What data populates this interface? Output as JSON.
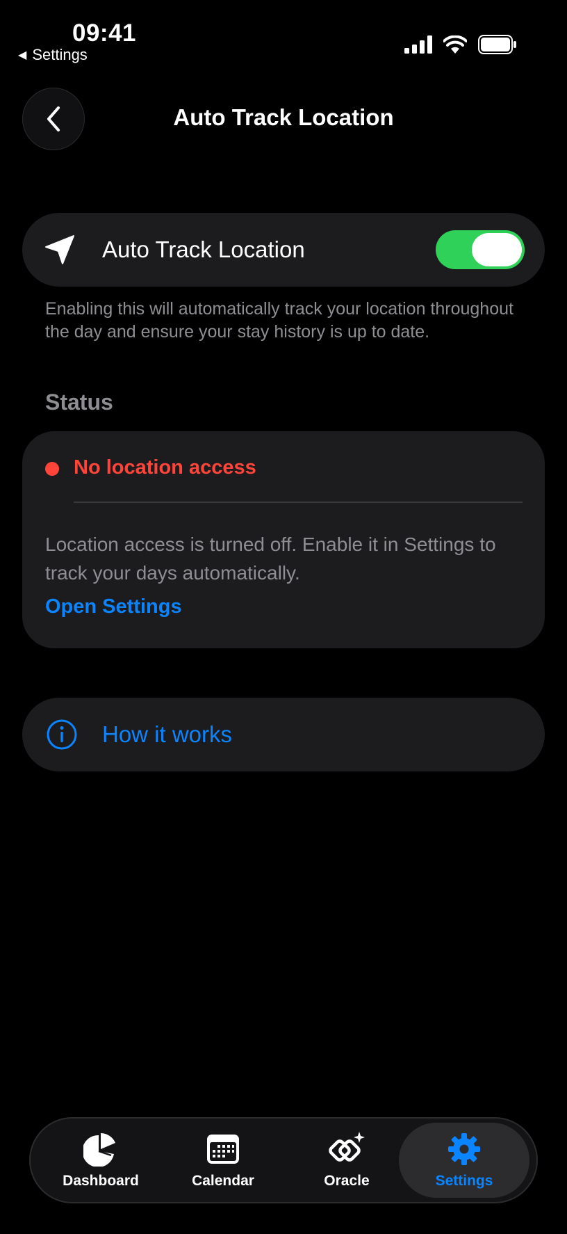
{
  "status_bar": {
    "time": "09:41",
    "back_app": "Settings",
    "back_glyph": "◀"
  },
  "header": {
    "title": "Auto Track Location",
    "back_icon": "chevron-left-icon"
  },
  "toggle": {
    "label": "Auto Track Location",
    "enabled": true,
    "icon": "location-arrow-icon",
    "on_color": "#30d158"
  },
  "description": "Enabling this will automatically track your location throughout the day and ensure your stay history is up to date.",
  "status": {
    "section_title": "Status",
    "message": "No location access",
    "message_color": "#ff453a",
    "detail": "Location access is turned off. Enable it in Settings to track your days automatically.",
    "action_label": "Open Settings"
  },
  "how_it_works": {
    "label": "How it works",
    "icon": "info-icon"
  },
  "tabbar": {
    "active": "Settings",
    "accent": "#0a84ff",
    "tabs": [
      {
        "label": "Dashboard",
        "icon": "pie-chart-icon"
      },
      {
        "label": "Calendar",
        "icon": "calendar-icon"
      },
      {
        "label": "Oracle",
        "icon": "oracle-icon"
      },
      {
        "label": "Settings",
        "icon": "gear-icon"
      }
    ]
  }
}
